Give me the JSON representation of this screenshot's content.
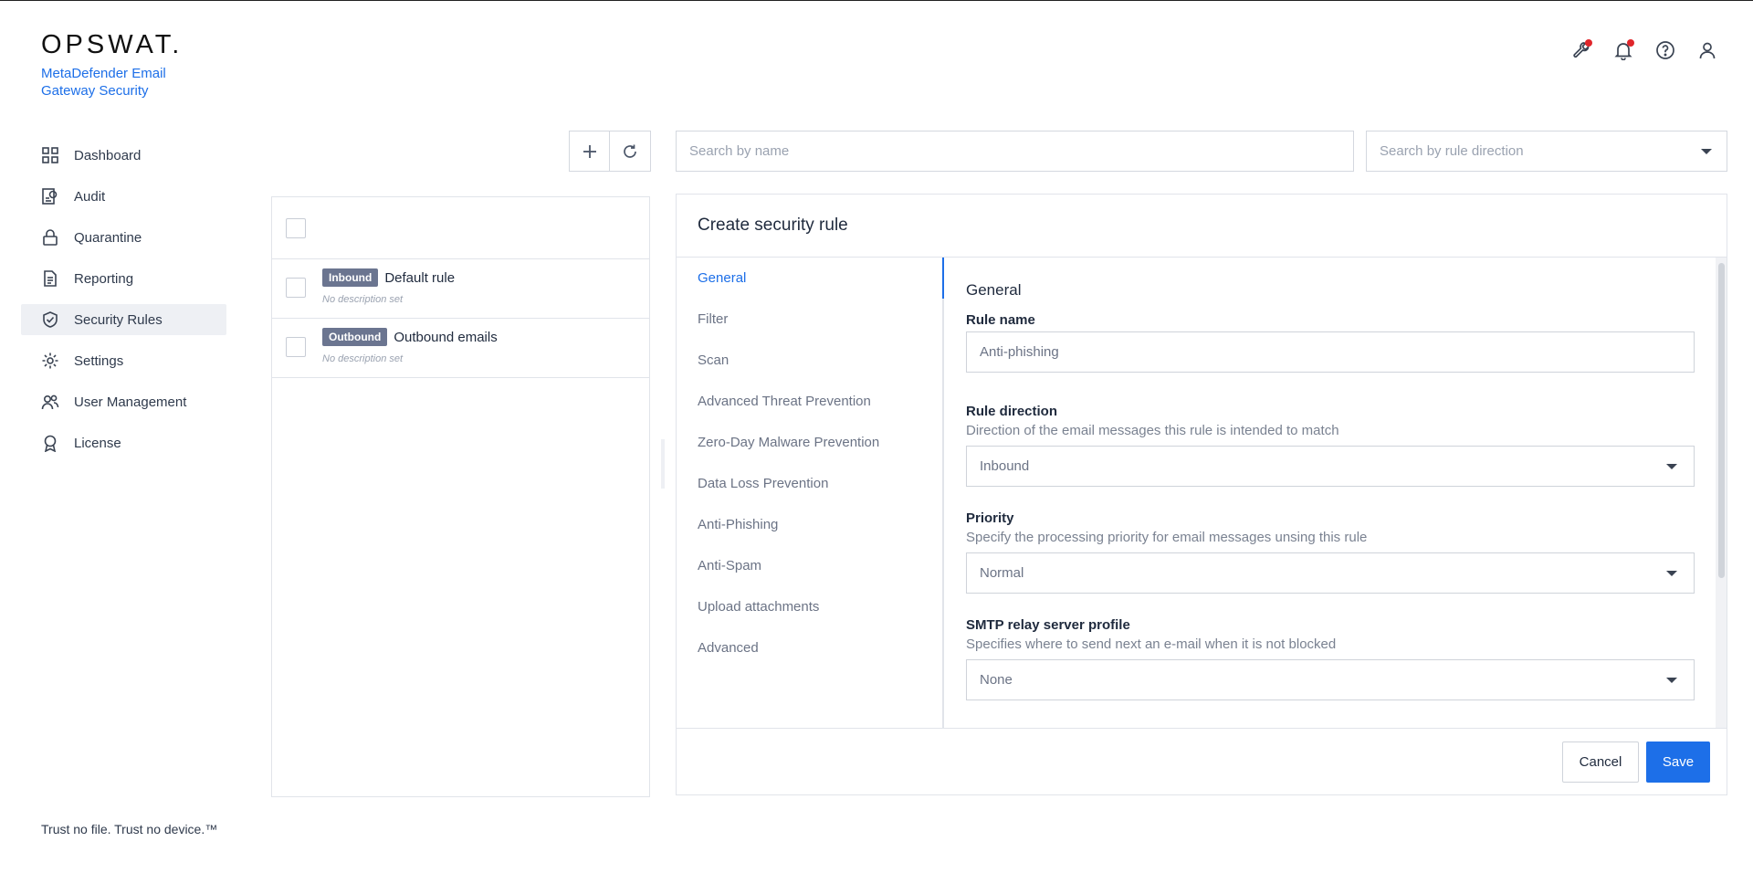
{
  "brand": {
    "logo": "OPSWAT.",
    "product": "MetaDefender Email Gateway Security",
    "tagline": "Trust no file. Trust no device.™"
  },
  "nav": {
    "items": [
      {
        "label": "Dashboard",
        "icon": "grid-icon"
      },
      {
        "label": "Audit",
        "icon": "audit-icon"
      },
      {
        "label": "Quarantine",
        "icon": "lock-icon"
      },
      {
        "label": "Reporting",
        "icon": "document-icon"
      },
      {
        "label": "Security Rules",
        "icon": "shield-check-icon",
        "active": true
      },
      {
        "label": "Settings",
        "icon": "gear-icon"
      },
      {
        "label": "User Management",
        "icon": "users-icon"
      },
      {
        "label": "License",
        "icon": "award-icon"
      }
    ]
  },
  "header_icons": [
    "wrench-icon",
    "bell-icon",
    "help-icon",
    "user-icon"
  ],
  "search": {
    "name_placeholder": "Search by name",
    "direction_placeholder": "Search by rule direction"
  },
  "rules": [
    {
      "direction": "Inbound",
      "name": "Default rule",
      "description": "No description set"
    },
    {
      "direction": "Outbound",
      "name": "Outbound emails",
      "description": "No description set"
    }
  ],
  "create": {
    "title": "Create security rule",
    "tabs": [
      "General",
      "Filter",
      "Scan",
      "Advanced Threat Prevention",
      "Zero-Day Malware Prevention",
      "Data Loss Prevention",
      "Anti-Phishing",
      "Anti-Spam",
      "Upload attachments",
      "Advanced"
    ],
    "active_tab": "General",
    "section_title": "General",
    "rule_name": {
      "label": "Rule name",
      "value": "Anti-phishing"
    },
    "rule_direction": {
      "label": "Rule direction",
      "help": "Direction of the email messages this rule is intended to match",
      "value": "Inbound"
    },
    "priority": {
      "label": "Priority",
      "help": "Specify the processing priority for email messages unsing this rule",
      "value": "Normal"
    },
    "smtp": {
      "label": "SMTP relay server profile",
      "help": "Specifies where to send next an e-mail when it is not blocked",
      "value": "None"
    },
    "cancel_label": "Cancel",
    "save_label": "Save"
  },
  "colors": {
    "accent": "#1d6fe8",
    "badge": "#6b7590",
    "notification_dot": "#e0262b"
  }
}
